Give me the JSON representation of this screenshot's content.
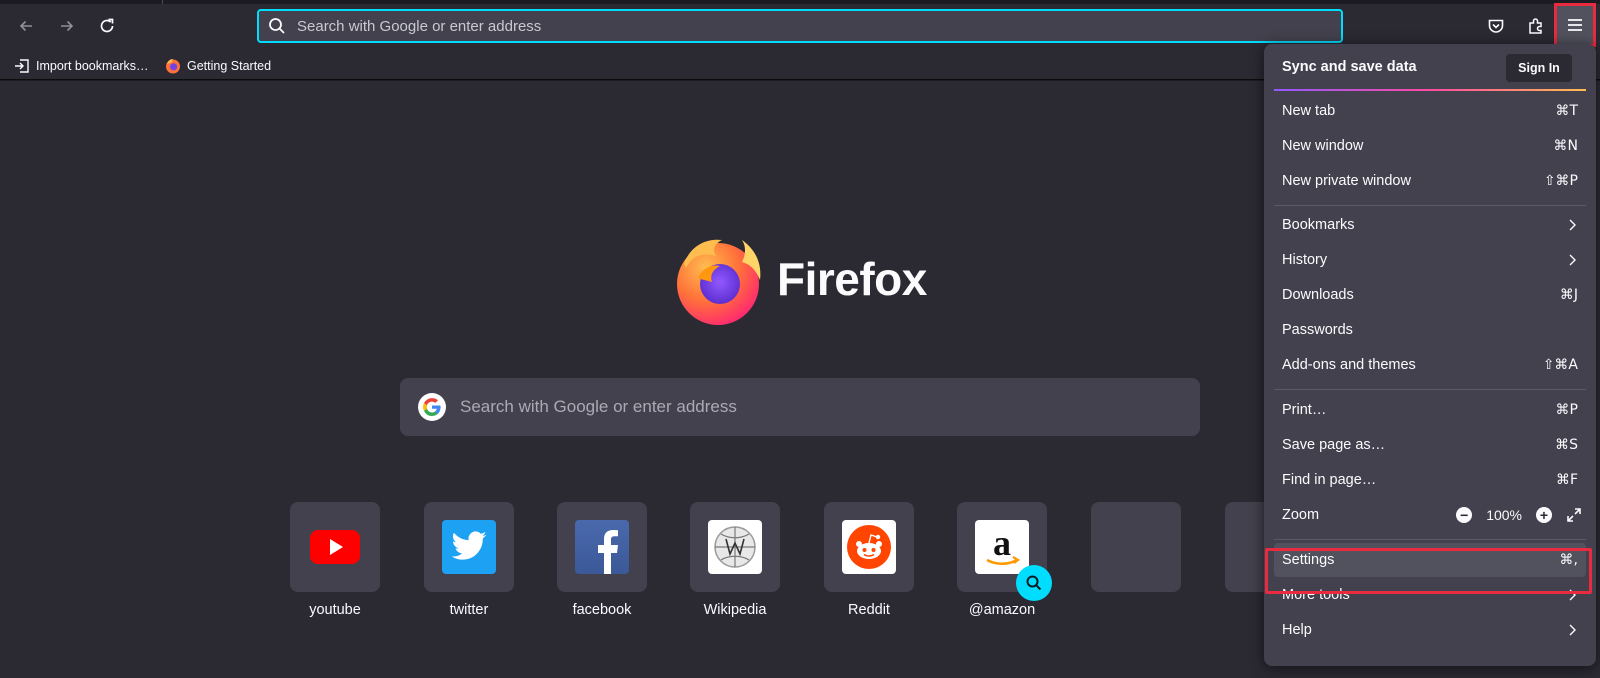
{
  "toolbar": {
    "url_placeholder": "Search with Google or enter address"
  },
  "bookmarks": [
    {
      "label": "Import bookmarks…",
      "icon": "import-icon"
    },
    {
      "label": "Getting Started",
      "icon": "firefox-icon"
    }
  ],
  "newtab": {
    "brand": "Firefox",
    "search_placeholder": "Search with Google or enter address",
    "tiles": [
      {
        "label": "youtube",
        "icon": "youtube-icon"
      },
      {
        "label": "twitter",
        "icon": "twitter-icon"
      },
      {
        "label": "facebook",
        "icon": "facebook-icon"
      },
      {
        "label": "Wikipedia",
        "icon": "wikipedia-icon"
      },
      {
        "label": "Reddit",
        "icon": "reddit-icon"
      },
      {
        "label": "@amazon",
        "icon": "amazon-icon"
      },
      {
        "label": "",
        "icon": ""
      },
      {
        "label": "",
        "icon": ""
      }
    ]
  },
  "menu": {
    "sync_title": "Sync and save data",
    "signin_label": "Sign In",
    "items": [
      {
        "label": "New tab",
        "shortcut": "⌘T"
      },
      {
        "label": "New window",
        "shortcut": "⌘N"
      },
      {
        "label": "New private window",
        "shortcut": "⇧⌘P"
      },
      {
        "label": "Bookmarks",
        "shortcut": ""
      },
      {
        "label": "History",
        "shortcut": ""
      },
      {
        "label": "Downloads",
        "shortcut": "⌘J"
      },
      {
        "label": "Passwords",
        "shortcut": ""
      },
      {
        "label": "Add-ons and themes",
        "shortcut": "⇧⌘A"
      },
      {
        "label": "Print…",
        "shortcut": "⌘P"
      },
      {
        "label": "Save page as…",
        "shortcut": "⌘S"
      },
      {
        "label": "Find in page…",
        "shortcut": "⌘F"
      },
      {
        "label": "Zoom",
        "shortcut": ""
      },
      {
        "label": "Settings",
        "shortcut": "⌘,"
      },
      {
        "label": "More tools",
        "shortcut": ""
      },
      {
        "label": "Help",
        "shortcut": ""
      }
    ],
    "zoom_value": "100%"
  },
  "colors": {
    "toolbar_bg": "#2b2a33",
    "panel_bg": "#42414d",
    "accent_focus": "#00ddff",
    "highlight": "#ea2b3f"
  }
}
